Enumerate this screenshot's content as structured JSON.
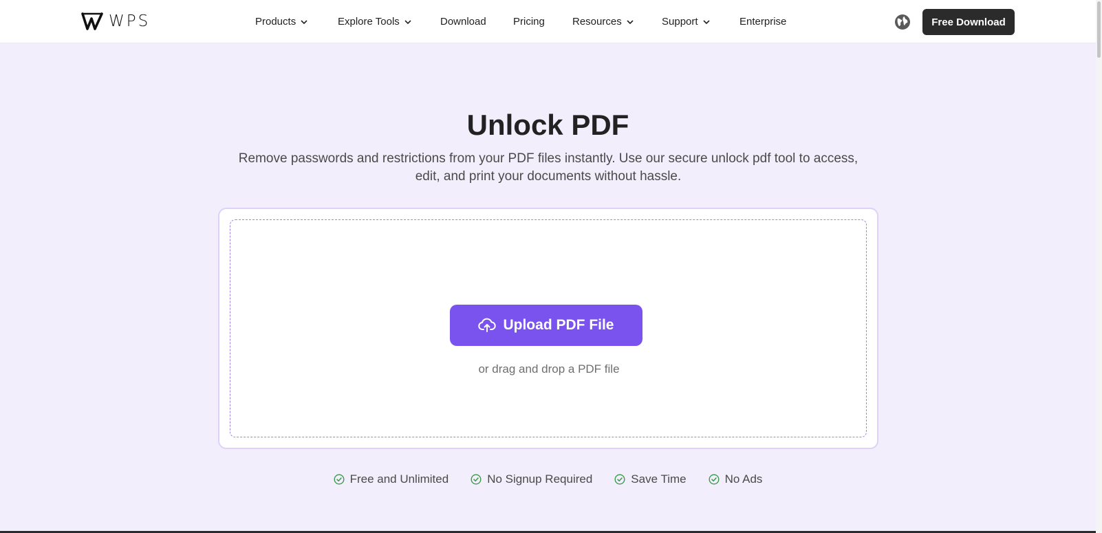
{
  "brand": {
    "logo_text": "WPS"
  },
  "nav": {
    "items": [
      {
        "label": "Products",
        "dropdown": true
      },
      {
        "label": "Explore Tools",
        "dropdown": true
      },
      {
        "label": "Download",
        "dropdown": false
      },
      {
        "label": "Pricing",
        "dropdown": false
      },
      {
        "label": "Resources",
        "dropdown": true
      },
      {
        "label": "Support",
        "dropdown": true
      },
      {
        "label": "Enterprise",
        "dropdown": false
      }
    ],
    "language_icon": "globe-icon",
    "cta_label": "Free Download"
  },
  "hero": {
    "title": "Unlock PDF",
    "subtitle": "Remove passwords and restrictions from your PDF files instantly. Use our secure unlock pdf tool to access, edit, and print your documents without hassle."
  },
  "upload": {
    "button_label": "Upload PDF File",
    "button_icon": "cloud-upload-icon",
    "hint": "or drag and drop a PDF file"
  },
  "features": [
    {
      "label": "Free and Unlimited",
      "icon": "check-circle-icon"
    },
    {
      "label": "No Signup Required",
      "icon": "check-circle-icon"
    },
    {
      "label": "Save Time",
      "icon": "check-circle-icon"
    },
    {
      "label": "No Ads",
      "icon": "check-circle-icon"
    }
  ],
  "colors": {
    "accent": "#7a52ee",
    "background": "#f2eefc",
    "cta": "#2b2b2b",
    "check": "#3a9a4a"
  }
}
